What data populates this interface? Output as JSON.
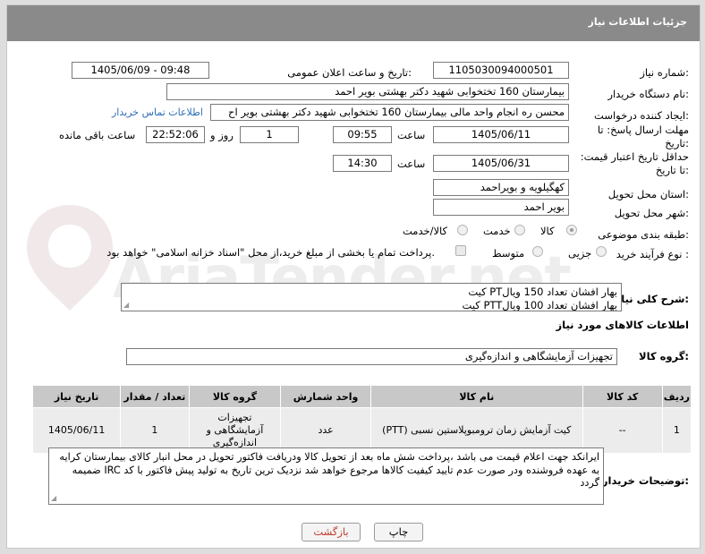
{
  "header": {
    "title": "جزئیات اطلاعات نیاز"
  },
  "fields": {
    "need_number": {
      "label": "شماره نیاز:",
      "value": "1105030094000501"
    },
    "announce": {
      "label": "تاریخ و ساعت اعلان عمومی:",
      "value": "1405/06/09 - 09:48"
    },
    "buyer_org": {
      "label": "نام دستگاه خریدار:",
      "value": "بیمارستان 160 تختخوابی شهید دکتر بهشتی بویر احمد"
    },
    "requester": {
      "label": "ایجاد کننده درخواست:",
      "value": "محسن ره انجام واحد مالی بیمارستان 160 تختخوابی شهید دکتر بهشتی بویر اح",
      "contact_link": "اطلاعات تماس خریدار"
    },
    "reply_deadline": {
      "label": "مهلت ارسال پاسخ: تا تاریخ:",
      "date": "1405/06/11",
      "time_label": "ساعت",
      "time": "09:55",
      "days": "1",
      "days_label": "روز و",
      "remaining": "22:52:06",
      "remaining_label": "ساعت باقی مانده"
    },
    "price_validity": {
      "label": "حداقل تاریخ اعتبار قیمت: تا تاریخ:",
      "date": "1405/06/31",
      "time_label": "ساعت",
      "time": "14:30"
    },
    "province": {
      "label": "استان محل تحویل:",
      "value": "کهگیلویه و بویراحمد"
    },
    "city": {
      "label": "شهر محل تحویل:",
      "value": "بویر احمد"
    },
    "category": {
      "label": "طبقه بندی موضوعی:",
      "options": [
        "کالا",
        "خدمت",
        "کالا/خدمت"
      ],
      "selected": "کالا"
    },
    "process": {
      "label": "نوع فرآیند خرید :",
      "options": [
        "جزیی",
        "متوسط"
      ],
      "checkbox_text": "پرداخت تمام یا بخشی از مبلغ خرید،از محل \"اسناد خزانه اسلامی\" خواهد بود."
    }
  },
  "summary": {
    "label": "شرح کلی نیاز:",
    "lines": [
      "کیت PTبهار افشان تعداد 150 ویال",
      "کیت   PTTبهار افشان تعداد 100 ویال"
    ]
  },
  "goods_info_title": "اطلاعات کالاهای مورد نیاز",
  "goods_group": {
    "label": "گروه کالا:",
    "value": "تجهیزات آزمایشگاهی و اندازه‌گیری"
  },
  "table": {
    "headers": [
      "ردیف",
      "کد کالا",
      "نام کالا",
      "واحد شمارش",
      "گروه کالا",
      "تعداد / مقدار",
      "تاریخ نیاز"
    ],
    "rows": [
      {
        "row": "1",
        "code": "--",
        "name": "کیت آزمایش زمان ترومبوپلاستین نسبی (PTT)",
        "unit": "عدد",
        "group": "تجهیزات آزمایشگاهی و اندازه‌گیری",
        "qty": "1",
        "date": "1405/06/11"
      }
    ]
  },
  "buyer_notes": {
    "label": "توضیحات خریدار:",
    "text": "ایرانکد جهت اعلام قیمت می باشد ،پرداخت شش ماه بعد از تحویل کالا ودریافت فاکتور تحویل در محل انبار کالای بیمارستان کرایه به عهده فروشنده ودر صورت عدم تایید کیفیت کالاها مرجوع خواهد شد نزدیک ترین تاریخ به تولید پیش فاکتور با کد IRC ضمیمه گردد"
  },
  "buttons": {
    "print": "چاپ",
    "back": "بازگشت"
  },
  "watermark": "AriaTender.net"
}
